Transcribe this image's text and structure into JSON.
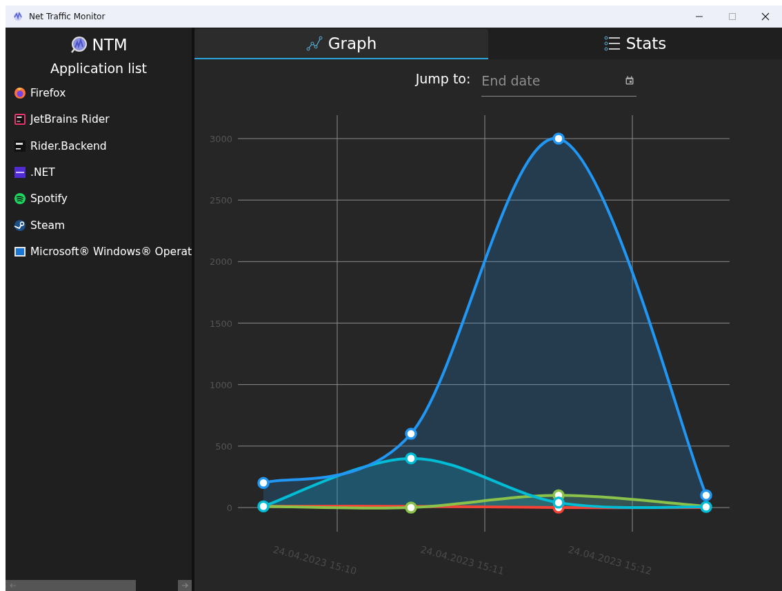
{
  "window": {
    "title": "Net Traffic Monitor"
  },
  "sidebar": {
    "logo": "NTM",
    "heading": "Application list",
    "items": [
      {
        "label": "Firefox"
      },
      {
        "label": "JetBrains Rider"
      },
      {
        "label": "Rider.Backend"
      },
      {
        "label": ".NET"
      },
      {
        "label": "Spotify"
      },
      {
        "label": "Steam"
      },
      {
        "label": "Microsoft® Windows® Operat"
      }
    ]
  },
  "tabs": [
    {
      "label": "Graph",
      "selected": true
    },
    {
      "label": "Stats",
      "selected": false
    }
  ],
  "date_filter": {
    "label": "Jump to:",
    "placeholder": "End date"
  },
  "chart_data": {
    "type": "area",
    "grid": true,
    "ylim": [
      0,
      3000
    ],
    "categories": [
      "24.04.2023 15:10",
      "24.04.2023 15:11",
      "24.04.2023 15:12",
      null
    ],
    "yticks": [
      0,
      500,
      1000,
      1500,
      2000,
      2500,
      3000
    ],
    "series": [
      {
        "color": "#2196f3",
        "values": [
          200,
          600,
          3000,
          100
        ]
      },
      {
        "color": "#00bcd4",
        "values": [
          10,
          400,
          40,
          5
        ]
      },
      {
        "color": "#8bc34a",
        "values": [
          10,
          0,
          100,
          10
        ]
      },
      {
        "color": "#f44336",
        "values": [
          10,
          10,
          0,
          0
        ]
      }
    ]
  }
}
